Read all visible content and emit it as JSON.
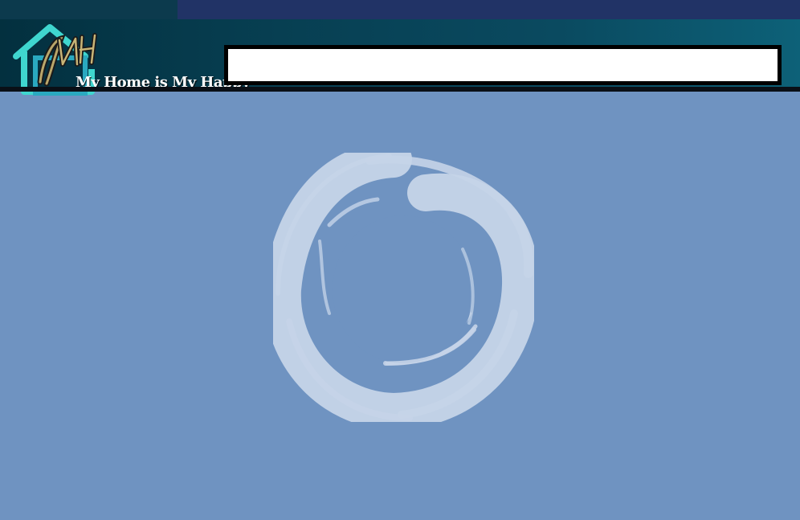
{
  "header": {
    "brand_name": "My Home is My Happy",
    "brand_monogram": "MH",
    "logo_icon": "house-icon"
  },
  "search": {
    "value": "",
    "placeholder": ""
  },
  "loading": {
    "icon": "brush-circle-spinner-icon"
  },
  "colors": {
    "page_background": "#6f93c1",
    "header_dark": "#03303f",
    "header_light": "#0d6178",
    "top_strip": "#213366",
    "spinner": "#c5d4e8",
    "logo_house": "#3fd6cf"
  }
}
